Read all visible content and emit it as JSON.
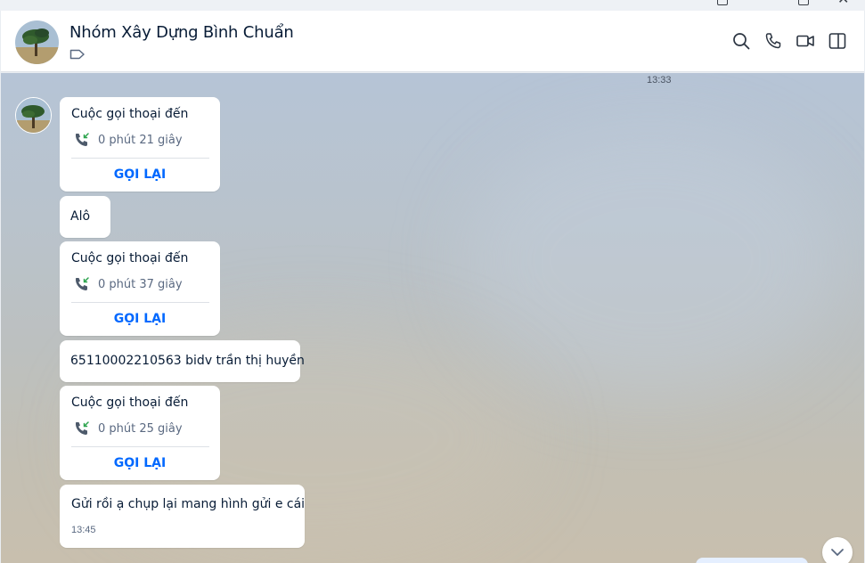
{
  "window": {
    "close_glyph": "✕"
  },
  "header": {
    "title": "Nhóm Xây Dựng Bình Chuẩn",
    "icons": [
      "search-icon",
      "phone-icon",
      "video-icon",
      "sidebar-toggle-icon",
      "tag-icon"
    ]
  },
  "chat": {
    "top_timestamp": "13:33",
    "messages": [
      {
        "type": "call",
        "title": "Cuộc gọi thoại đến",
        "duration": "0 phút 21 giây",
        "action": "GỌI LẠI"
      },
      {
        "type": "text",
        "text": "Alô"
      },
      {
        "type": "call",
        "title": "Cuộc gọi thoại đến",
        "duration": "0 phút 37 giây",
        "action": "GỌI LẠI"
      },
      {
        "type": "text",
        "text": "65110002210563 bidv trần thị huyền"
      },
      {
        "type": "call",
        "title": "Cuộc gọi thoại đến",
        "duration": "0 phút 25 giây",
        "action": "GỌI LẠI"
      },
      {
        "type": "text",
        "text": "Gửi rồi ạ chụp lại mang hình gửi e cái",
        "time": "13:45"
      }
    ]
  },
  "colors": {
    "accent": "#0068ff",
    "text": "#081c36",
    "muted": "#5a6981",
    "missed_call_arrow": "#2da44e"
  }
}
